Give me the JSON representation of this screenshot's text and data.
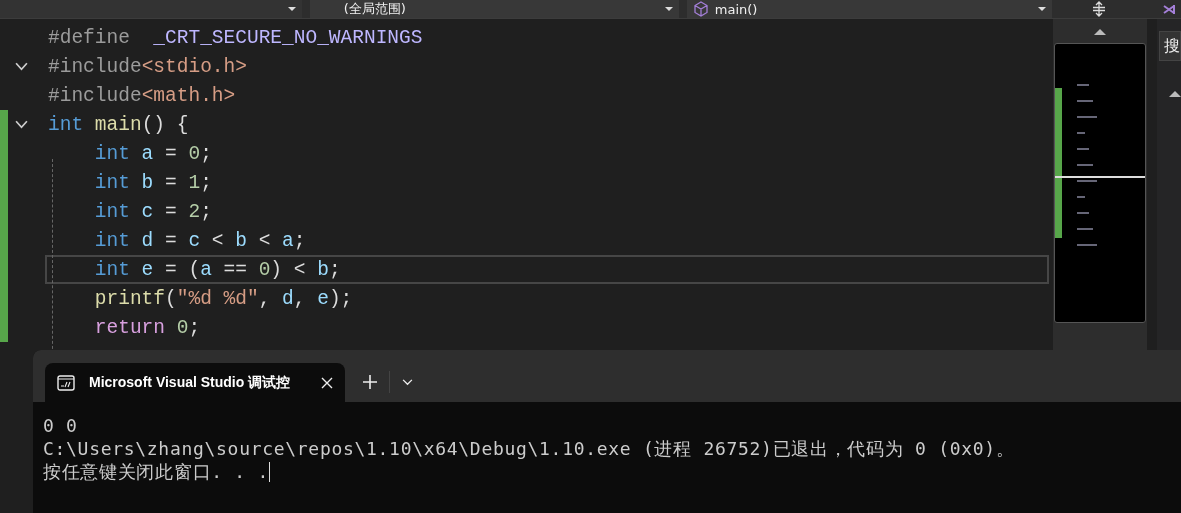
{
  "navbar": {
    "dropdowns": [
      {
        "label": "(全局范围)"
      },
      {
        "label": "main()"
      }
    ]
  },
  "side_panel": {
    "search_text": "搜"
  },
  "editor": {
    "lines": [
      {
        "fold": false,
        "changed": false,
        "current": false,
        "tokens": [
          {
            "text": "#define",
            "kind": "preproc"
          },
          {
            "text": "  _CRT_SECURE_NO_WARNINGS",
            "kind": "macro"
          }
        ]
      },
      {
        "fold": true,
        "changed": false,
        "current": false,
        "tokens": [
          {
            "text": "#include",
            "kind": "preproc"
          },
          {
            "text": "<stdio.h>",
            "kind": "string"
          }
        ]
      },
      {
        "fold": false,
        "changed": false,
        "current": false,
        "tokens": [
          {
            "text": "#include",
            "kind": "preproc"
          },
          {
            "text": "<math.h>",
            "kind": "string"
          }
        ]
      },
      {
        "fold": true,
        "changed": true,
        "current": false,
        "tokens": [
          {
            "text": "int ",
            "kind": "keyword"
          },
          {
            "text": "main",
            "kind": "func"
          },
          {
            "text": "() {",
            "kind": "plain"
          }
        ]
      },
      {
        "fold": false,
        "changed": true,
        "current": false,
        "tokens": [
          {
            "text": "    int",
            "kind": "keyword"
          },
          {
            "text": " a",
            "kind": "var"
          },
          {
            "text": " = ",
            "kind": "plain"
          },
          {
            "text": "0",
            "kind": "number"
          },
          {
            "text": ";",
            "kind": "plain"
          }
        ]
      },
      {
        "fold": false,
        "changed": true,
        "current": false,
        "tokens": [
          {
            "text": "    int",
            "kind": "keyword"
          },
          {
            "text": " b",
            "kind": "var"
          },
          {
            "text": " = ",
            "kind": "plain"
          },
          {
            "text": "1",
            "kind": "number"
          },
          {
            "text": ";",
            "kind": "plain"
          }
        ]
      },
      {
        "fold": false,
        "changed": true,
        "current": false,
        "tokens": [
          {
            "text": "    int",
            "kind": "keyword"
          },
          {
            "text": " c",
            "kind": "var"
          },
          {
            "text": " = ",
            "kind": "plain"
          },
          {
            "text": "2",
            "kind": "number"
          },
          {
            "text": ";",
            "kind": "plain"
          }
        ]
      },
      {
        "fold": false,
        "changed": true,
        "current": false,
        "tokens": [
          {
            "text": "    int",
            "kind": "keyword"
          },
          {
            "text": " d",
            "kind": "var"
          },
          {
            "text": " = ",
            "kind": "plain"
          },
          {
            "text": "c",
            "kind": "var"
          },
          {
            "text": " < ",
            "kind": "plain"
          },
          {
            "text": "b",
            "kind": "var"
          },
          {
            "text": " < ",
            "kind": "plain"
          },
          {
            "text": "a",
            "kind": "var"
          },
          {
            "text": ";",
            "kind": "plain"
          }
        ]
      },
      {
        "fold": false,
        "changed": true,
        "current": true,
        "tokens": [
          {
            "text": "    int",
            "kind": "keyword"
          },
          {
            "text": " e",
            "kind": "var"
          },
          {
            "text": " = (",
            "kind": "plain"
          },
          {
            "text": "a",
            "kind": "var"
          },
          {
            "text": " == ",
            "kind": "plain"
          },
          {
            "text": "0",
            "kind": "number"
          },
          {
            "text": ") < ",
            "kind": "plain"
          },
          {
            "text": "b",
            "kind": "var"
          },
          {
            "text": ";",
            "kind": "plain"
          }
        ]
      },
      {
        "fold": false,
        "changed": true,
        "current": false,
        "tokens": [
          {
            "text": "    printf",
            "kind": "func"
          },
          {
            "text": "(",
            "kind": "plain"
          },
          {
            "text": "\"%d %d\"",
            "kind": "string"
          },
          {
            "text": ", ",
            "kind": "plain"
          },
          {
            "text": "d",
            "kind": "var"
          },
          {
            "text": ", ",
            "kind": "plain"
          },
          {
            "text": "e",
            "kind": "var"
          },
          {
            "text": ");",
            "kind": "plain"
          }
        ]
      },
      {
        "fold": false,
        "changed": true,
        "current": false,
        "tokens": [
          {
            "text": "    return ",
            "kind": "control"
          },
          {
            "text": "0",
            "kind": "number"
          },
          {
            "text": ";",
            "kind": "plain"
          }
        ]
      }
    ]
  },
  "console": {
    "tab_title": "Microsoft Visual Studio 调试控",
    "lines": [
      "0 0",
      "C:\\Users\\zhang\\source\\repos\\1.10\\x64\\Debug\\1.10.exe (进程 26752)已退出，代码为 0 (0x0)。",
      "按任意键关闭此窗口. . ."
    ],
    "cursor": true
  }
}
